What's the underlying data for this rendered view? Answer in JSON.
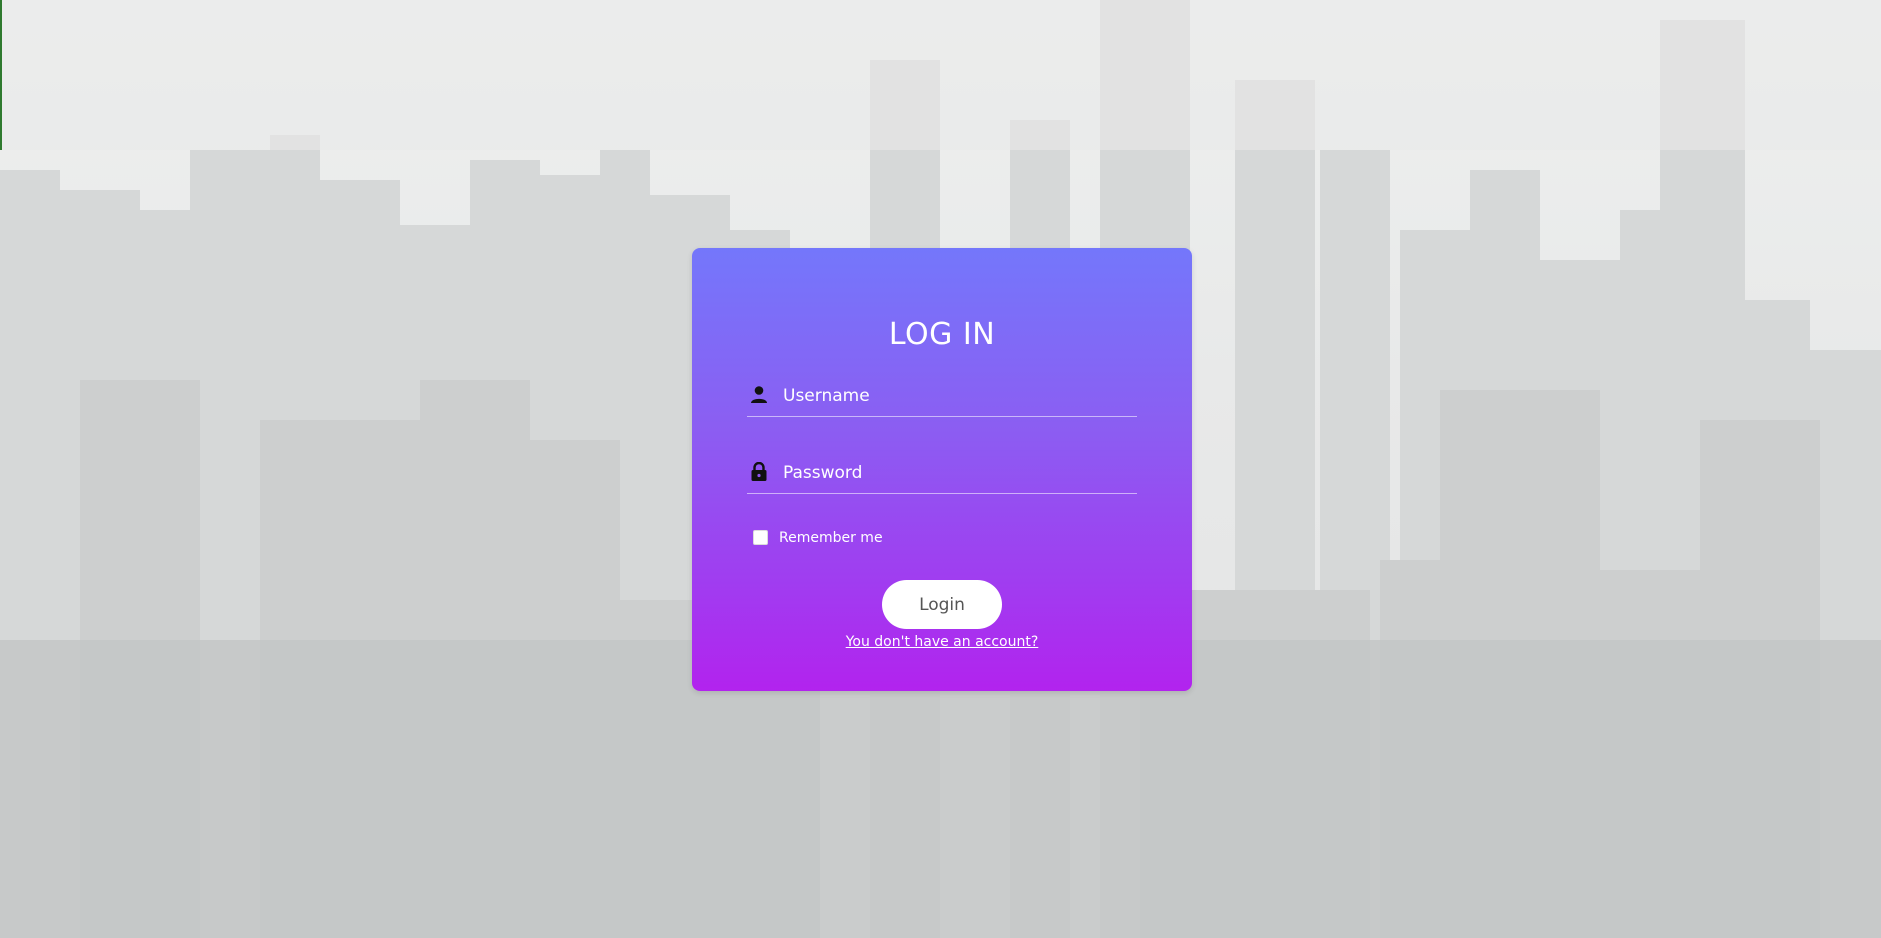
{
  "login_form": {
    "title": "LOG IN",
    "username": {
      "placeholder": "Username",
      "value": "",
      "icon": "person-icon"
    },
    "password": {
      "placeholder": "Password",
      "value": "",
      "icon": "lock-icon"
    },
    "remember_me": {
      "label": "Remember me",
      "checked": false
    },
    "submit_label": "Login",
    "signup_link": "You don't have an account?"
  },
  "colors": {
    "card_gradient_top": "#7477fb",
    "card_gradient_bottom": "#b223ee",
    "button_background": "#ffffff",
    "button_text": "#555555"
  }
}
